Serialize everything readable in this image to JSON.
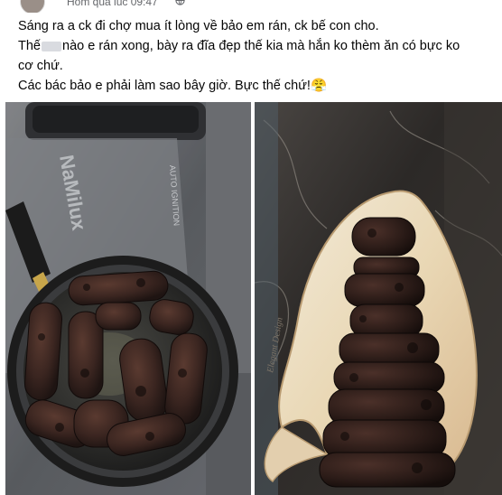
{
  "post": {
    "timestamp": "Hôm qua lúc 09:47",
    "line1": "Sáng ra a ck đi chợ mua ít lòng về bảo em rán, ck bế con cho.",
    "line2_a": "Thế",
    "line2_b": "nào e rán xong, bày ra đĩa đẹp thế kia mà hắn ko thèm ăn có bực ko",
    "line3": "cơ chứ.",
    "line4": "Các bác bảo e phải làm sao bây giờ. Bực thế chứ!",
    "emoji": "😤"
  },
  "photos": {
    "left": {
      "stove_brand": "NaMilux",
      "stove_text": "AUTO IGNITION"
    },
    "right": {
      "watermark": "Elegant Design"
    }
  }
}
